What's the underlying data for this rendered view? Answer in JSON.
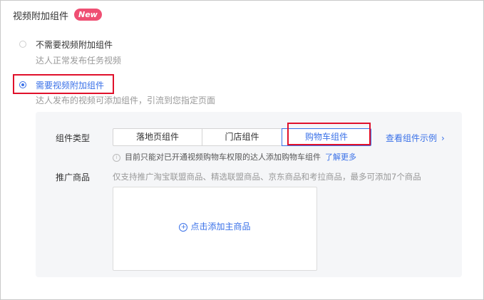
{
  "header": {
    "title": "视频附加组件",
    "badge": "New"
  },
  "options": [
    {
      "label": "不需要视频附加组件",
      "description": "达人正常发布任务视频",
      "selected": false
    },
    {
      "label": "需要视频附加组件",
      "description": "达人发布的视频可添加组件，引流到您指定页面",
      "selected": true
    }
  ],
  "component": {
    "type_label": "组件类型",
    "segments": [
      {
        "label": "落地页组件",
        "selected": false
      },
      {
        "label": "门店组件",
        "selected": false
      },
      {
        "label": "购物车组件",
        "selected": true
      }
    ],
    "example_link": "查看组件示例",
    "hint_text": "目前只能对已开通视频购物车权限的达人添加购物车组件",
    "hint_link": "了解更多"
  },
  "product": {
    "label": "推广商品",
    "description": "仅支持推广淘宝联盟商品、精选联盟商品、京东商品和考拉商品，最多可添加7个商品",
    "add_label": "点击添加主商品"
  },
  "colors": {
    "accent": "#3a71e8",
    "badge": "#ef4f73",
    "highlight": "#e0112b",
    "panel_bg": "#f5f6f8"
  },
  "icons": {
    "hint": "info-icon",
    "add": "plus-circle-icon",
    "example": "chevron-right-icon"
  }
}
